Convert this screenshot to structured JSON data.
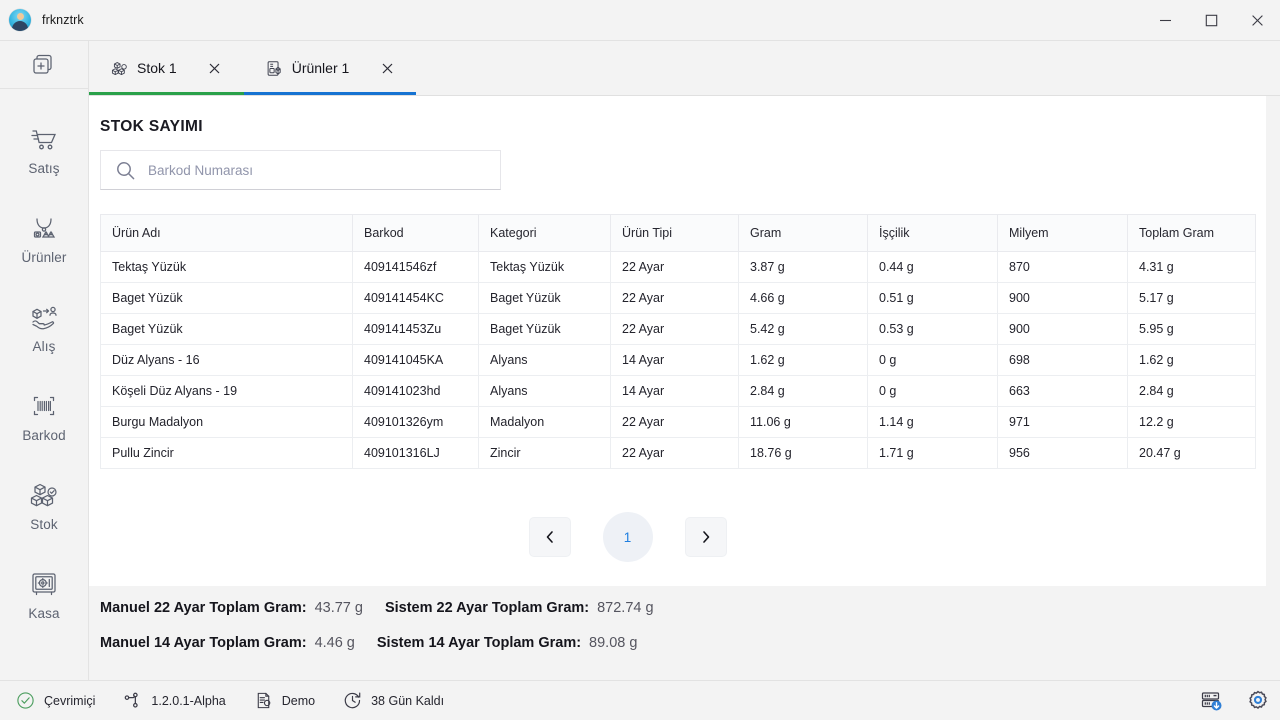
{
  "window": {
    "title": "frknztrk",
    "avatar_icon": "user-avatar-icon",
    "minimize_label": "—",
    "maximize_label": "☐",
    "close_label": "✕"
  },
  "sidebar": {
    "add_button": {
      "icon": "add-tab-icon",
      "label": ""
    },
    "items": [
      {
        "label": "Satış",
        "icon": "shopping-cart-icon",
        "active": false
      },
      {
        "label": "Ürünler",
        "icon": "jewelry-necklace-icon",
        "active": false
      },
      {
        "label": "Alış",
        "icon": "purchase-hand-box-icon",
        "active": false
      },
      {
        "label": "Barkod",
        "icon": "barcode-icon",
        "active": false
      },
      {
        "label": "Stok",
        "icon": "stock-boxes-icon",
        "active": false
      },
      {
        "label": "Kasa",
        "icon": "safe-box-icon",
        "active": false
      }
    ]
  },
  "tabs": [
    {
      "label": "Stok 1",
      "icon": "stock-boxes-icon",
      "accent": "#2aa14a",
      "close_label": "✕"
    },
    {
      "label": "Ürünler 1",
      "icon": "products-icon",
      "accent": "#1673d2",
      "close_label": "✕"
    }
  ],
  "main": {
    "page_title": "STOK SAYIMI",
    "search": {
      "icon": "search-icon",
      "placeholder": "Barkod Numarası",
      "value": ""
    },
    "table": {
      "columns": [
        "Ürün Adı",
        "Barkod",
        "Kategori",
        "Ürün Tipi",
        "Gram",
        "İşçilik",
        "Milyem",
        "Toplam Gram"
      ],
      "rows": [
        [
          "Tektaş Yüzük",
          "409141546zf",
          "Tektaş Yüzük",
          "22 Ayar",
          "3.87 g",
          "0.44 g",
          "870",
          "4.31 g"
        ],
        [
          "Baget Yüzük",
          "409141454KC",
          "Baget Yüzük",
          "22 Ayar",
          "4.66 g",
          "0.51 g",
          "900",
          "5.17 g"
        ],
        [
          "Baget Yüzük",
          "409141453Zu",
          "Baget Yüzük",
          "22 Ayar",
          "5.42 g",
          "0.53 g",
          "900",
          "5.95 g"
        ],
        [
          "Düz Alyans - 16",
          "409141045KA",
          "Alyans",
          "14 Ayar",
          "1.62 g",
          "0 g",
          "698",
          "1.62 g"
        ],
        [
          "Köşeli Düz Alyans - 19",
          "409141023hd",
          "Alyans",
          "14 Ayar",
          "2.84 g",
          "0 g",
          "663",
          "2.84 g"
        ],
        [
          "Burgu Madalyon",
          "409101326ym",
          "Madalyon",
          "22 Ayar",
          "11.06 g",
          "1.14 g",
          "971",
          "12.2 g"
        ],
        [
          "Pullu Zincir",
          "409101316LJ",
          "Zincir",
          "22 Ayar",
          "18.76 g",
          "1.71 g",
          "956",
          "20.47 g"
        ]
      ]
    },
    "pagination": {
      "prev_label": "‹",
      "next_label": "›",
      "current_page": "1"
    },
    "summary": [
      {
        "left_label": "Manuel 22 Ayar Toplam Gram:",
        "left_value": "43.77 g",
        "right_label": "Sistem 22 Ayar Toplam Gram:",
        "right_value": "872.74 g"
      },
      {
        "left_label": "Manuel 14 Ayar Toplam Gram:",
        "left_value": "4.46 g",
        "right_label": "Sistem 14 Ayar Toplam Gram:",
        "right_value": "89.08 g"
      }
    ]
  },
  "statusbar": {
    "items": [
      {
        "label": "Çevrimiçi",
        "icon": "check-circle-icon"
      },
      {
        "label": "1.2.0.1-Alpha",
        "icon": "git-branch-icon"
      },
      {
        "label": "Demo",
        "icon": "document-license-icon"
      },
      {
        "label": "38 Gün Kaldı",
        "icon": "clock-refresh-icon"
      }
    ],
    "right": [
      {
        "icon": "database-download-icon"
      },
      {
        "icon": "gear-icon"
      }
    ]
  },
  "colors": {
    "tab_accent_active": "#1673d2",
    "tab_accent_stok": "#2aa14a",
    "page_number": "#1f7fe0",
    "background": "#f3f3f3",
    "card": "#ffffff"
  }
}
